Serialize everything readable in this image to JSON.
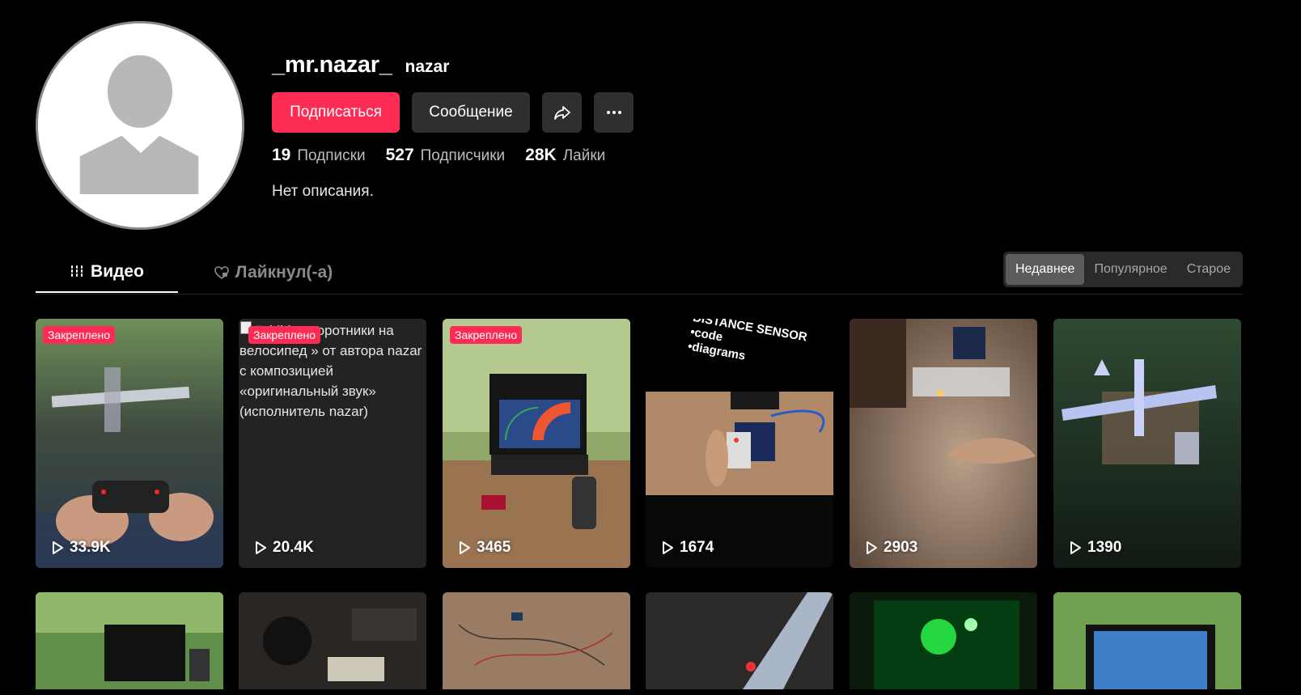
{
  "profile": {
    "username": "_mr.nazar_",
    "nickname": "nazar",
    "follow_label": "Подписаться",
    "message_label": "Сообщение",
    "share_icon": "share-icon",
    "more_icon": "more-icon",
    "stats": [
      {
        "value": "19",
        "label": "Подписки"
      },
      {
        "value": "527",
        "label": "Подписчики"
      },
      {
        "value": "28K",
        "label": "Лайки"
      }
    ],
    "bio": "Нет описания."
  },
  "tabs": {
    "videos_label": "Видео",
    "liked_label": "Лайкнул(-а)"
  },
  "sort": {
    "options": [
      "Недавнее",
      "Популярное",
      "Старое"
    ],
    "active": "Недавнее"
  },
  "colors": {
    "accent": "#fe2c55",
    "background": "#000000",
    "button_dark": "#2f2f2f"
  },
  "videos": [
    {
      "pinned_label": "Закреплено",
      "views": "33.9K"
    },
    {
      "pinned_label": "Закреплено",
      "views": "20.4K",
      "alt_text": "#ghjhj поворотники на велосипед » от автора nazar с композицией «оригинальный звук» (исполнитель nazar)"
    },
    {
      "pinned_label": "Закреплено",
      "views": "3465"
    },
    {
      "views": "1674",
      "overlay_text": "DISTANCE SENSOR\n•code\n•diagrams"
    },
    {
      "views": "2903"
    },
    {
      "views": "1390"
    }
  ]
}
